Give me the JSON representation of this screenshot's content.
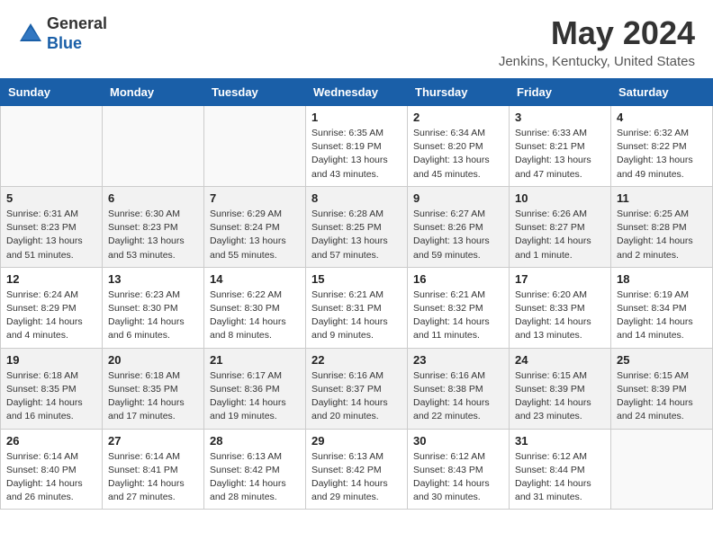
{
  "header": {
    "logo_line1": "General",
    "logo_line2": "Blue",
    "main_title": "May 2024",
    "subtitle": "Jenkins, Kentucky, United States"
  },
  "days_of_week": [
    "Sunday",
    "Monday",
    "Tuesday",
    "Wednesday",
    "Thursday",
    "Friday",
    "Saturday"
  ],
  "weeks": [
    [
      {
        "day": "",
        "info": ""
      },
      {
        "day": "",
        "info": ""
      },
      {
        "day": "",
        "info": ""
      },
      {
        "day": "1",
        "info": "Sunrise: 6:35 AM\nSunset: 8:19 PM\nDaylight: 13 hours\nand 43 minutes."
      },
      {
        "day": "2",
        "info": "Sunrise: 6:34 AM\nSunset: 8:20 PM\nDaylight: 13 hours\nand 45 minutes."
      },
      {
        "day": "3",
        "info": "Sunrise: 6:33 AM\nSunset: 8:21 PM\nDaylight: 13 hours\nand 47 minutes."
      },
      {
        "day": "4",
        "info": "Sunrise: 6:32 AM\nSunset: 8:22 PM\nDaylight: 13 hours\nand 49 minutes."
      }
    ],
    [
      {
        "day": "5",
        "info": "Sunrise: 6:31 AM\nSunset: 8:23 PM\nDaylight: 13 hours\nand 51 minutes."
      },
      {
        "day": "6",
        "info": "Sunrise: 6:30 AM\nSunset: 8:23 PM\nDaylight: 13 hours\nand 53 minutes."
      },
      {
        "day": "7",
        "info": "Sunrise: 6:29 AM\nSunset: 8:24 PM\nDaylight: 13 hours\nand 55 minutes."
      },
      {
        "day": "8",
        "info": "Sunrise: 6:28 AM\nSunset: 8:25 PM\nDaylight: 13 hours\nand 57 minutes."
      },
      {
        "day": "9",
        "info": "Sunrise: 6:27 AM\nSunset: 8:26 PM\nDaylight: 13 hours\nand 59 minutes."
      },
      {
        "day": "10",
        "info": "Sunrise: 6:26 AM\nSunset: 8:27 PM\nDaylight: 14 hours\nand 1 minute."
      },
      {
        "day": "11",
        "info": "Sunrise: 6:25 AM\nSunset: 8:28 PM\nDaylight: 14 hours\nand 2 minutes."
      }
    ],
    [
      {
        "day": "12",
        "info": "Sunrise: 6:24 AM\nSunset: 8:29 PM\nDaylight: 14 hours\nand 4 minutes."
      },
      {
        "day": "13",
        "info": "Sunrise: 6:23 AM\nSunset: 8:30 PM\nDaylight: 14 hours\nand 6 minutes."
      },
      {
        "day": "14",
        "info": "Sunrise: 6:22 AM\nSunset: 8:30 PM\nDaylight: 14 hours\nand 8 minutes."
      },
      {
        "day": "15",
        "info": "Sunrise: 6:21 AM\nSunset: 8:31 PM\nDaylight: 14 hours\nand 9 minutes."
      },
      {
        "day": "16",
        "info": "Sunrise: 6:21 AM\nSunset: 8:32 PM\nDaylight: 14 hours\nand 11 minutes."
      },
      {
        "day": "17",
        "info": "Sunrise: 6:20 AM\nSunset: 8:33 PM\nDaylight: 14 hours\nand 13 minutes."
      },
      {
        "day": "18",
        "info": "Sunrise: 6:19 AM\nSunset: 8:34 PM\nDaylight: 14 hours\nand 14 minutes."
      }
    ],
    [
      {
        "day": "19",
        "info": "Sunrise: 6:18 AM\nSunset: 8:35 PM\nDaylight: 14 hours\nand 16 minutes."
      },
      {
        "day": "20",
        "info": "Sunrise: 6:18 AM\nSunset: 8:35 PM\nDaylight: 14 hours\nand 17 minutes."
      },
      {
        "day": "21",
        "info": "Sunrise: 6:17 AM\nSunset: 8:36 PM\nDaylight: 14 hours\nand 19 minutes."
      },
      {
        "day": "22",
        "info": "Sunrise: 6:16 AM\nSunset: 8:37 PM\nDaylight: 14 hours\nand 20 minutes."
      },
      {
        "day": "23",
        "info": "Sunrise: 6:16 AM\nSunset: 8:38 PM\nDaylight: 14 hours\nand 22 minutes."
      },
      {
        "day": "24",
        "info": "Sunrise: 6:15 AM\nSunset: 8:39 PM\nDaylight: 14 hours\nand 23 minutes."
      },
      {
        "day": "25",
        "info": "Sunrise: 6:15 AM\nSunset: 8:39 PM\nDaylight: 14 hours\nand 24 minutes."
      }
    ],
    [
      {
        "day": "26",
        "info": "Sunrise: 6:14 AM\nSunset: 8:40 PM\nDaylight: 14 hours\nand 26 minutes."
      },
      {
        "day": "27",
        "info": "Sunrise: 6:14 AM\nSunset: 8:41 PM\nDaylight: 14 hours\nand 27 minutes."
      },
      {
        "day": "28",
        "info": "Sunrise: 6:13 AM\nSunset: 8:42 PM\nDaylight: 14 hours\nand 28 minutes."
      },
      {
        "day": "29",
        "info": "Sunrise: 6:13 AM\nSunset: 8:42 PM\nDaylight: 14 hours\nand 29 minutes."
      },
      {
        "day": "30",
        "info": "Sunrise: 6:12 AM\nSunset: 8:43 PM\nDaylight: 14 hours\nand 30 minutes."
      },
      {
        "day": "31",
        "info": "Sunrise: 6:12 AM\nSunset: 8:44 PM\nDaylight: 14 hours\nand 31 minutes."
      },
      {
        "day": "",
        "info": ""
      }
    ]
  ]
}
